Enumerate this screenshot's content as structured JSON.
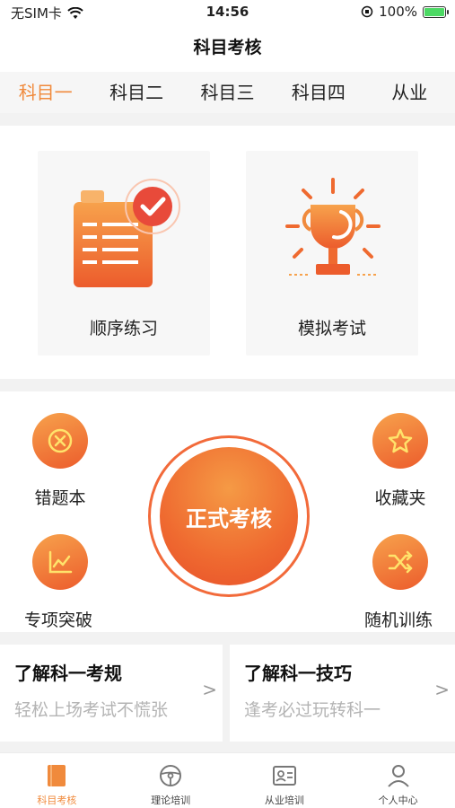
{
  "status_bar": {
    "carrier": "无SIM卡",
    "time": "14:56",
    "battery": "100%",
    "battery_level": 1.0
  },
  "header": {
    "title": "科目考核"
  },
  "tabs": [
    {
      "label": "科目一",
      "active": true
    },
    {
      "label": "科目二",
      "active": false
    },
    {
      "label": "科目三",
      "active": false
    },
    {
      "label": "科目四",
      "active": false
    },
    {
      "label": "从业",
      "active": false
    }
  ],
  "cards": [
    {
      "label": "顺序练习",
      "icon": "checklist-icon"
    },
    {
      "label": "模拟考试",
      "icon": "trophy-icon"
    }
  ],
  "actions": {
    "wrong_questions": "错题本",
    "favorites": "收藏夹",
    "special_topics": "专项突破",
    "random_training": "随机训练",
    "formal_exam": "正式考核"
  },
  "info_cards": [
    {
      "title": "了解科一考规",
      "subtitle": "轻松上场考试不慌张"
    },
    {
      "title": "了解科一技巧",
      "subtitle": "逢考必过玩转科一"
    }
  ],
  "tabbar": [
    {
      "label": "科目考核",
      "active": true,
      "icon": "book-icon"
    },
    {
      "label": "理论培训",
      "active": false,
      "icon": "steering-wheel-icon"
    },
    {
      "label": "从业培训",
      "active": false,
      "icon": "id-card-icon"
    },
    {
      "label": "个人中心",
      "active": false,
      "icon": "person-icon"
    }
  ],
  "colors": {
    "accent": "#f08a3c",
    "gradient_start": "#f7a24c",
    "gradient_end": "#ec5c2c"
  }
}
